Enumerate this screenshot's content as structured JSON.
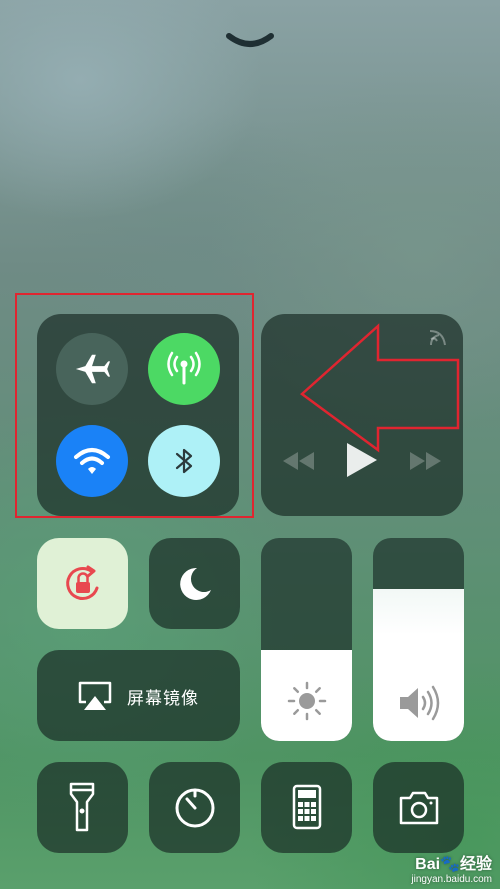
{
  "control_center": {
    "connectivity": {
      "airplane": "airplane-icon",
      "cellular": "cellular-data-icon",
      "wifi": "wifi-icon",
      "bluetooth": "bluetooth-icon",
      "colors": {
        "cellular_on": "#4cd964",
        "wifi_on": "#1a82f7",
        "bluetooth_on": "#aef1f7",
        "annotation": "#e02530"
      }
    },
    "screen_mirroring": {
      "label": "屏幕镜像"
    },
    "brightness": {
      "level": 0.45
    },
    "volume": {
      "level": 0.75
    }
  },
  "watermark": {
    "brand": "Bai",
    "brand_cn": "经验",
    "url": "jingyan.baidu.com"
  }
}
